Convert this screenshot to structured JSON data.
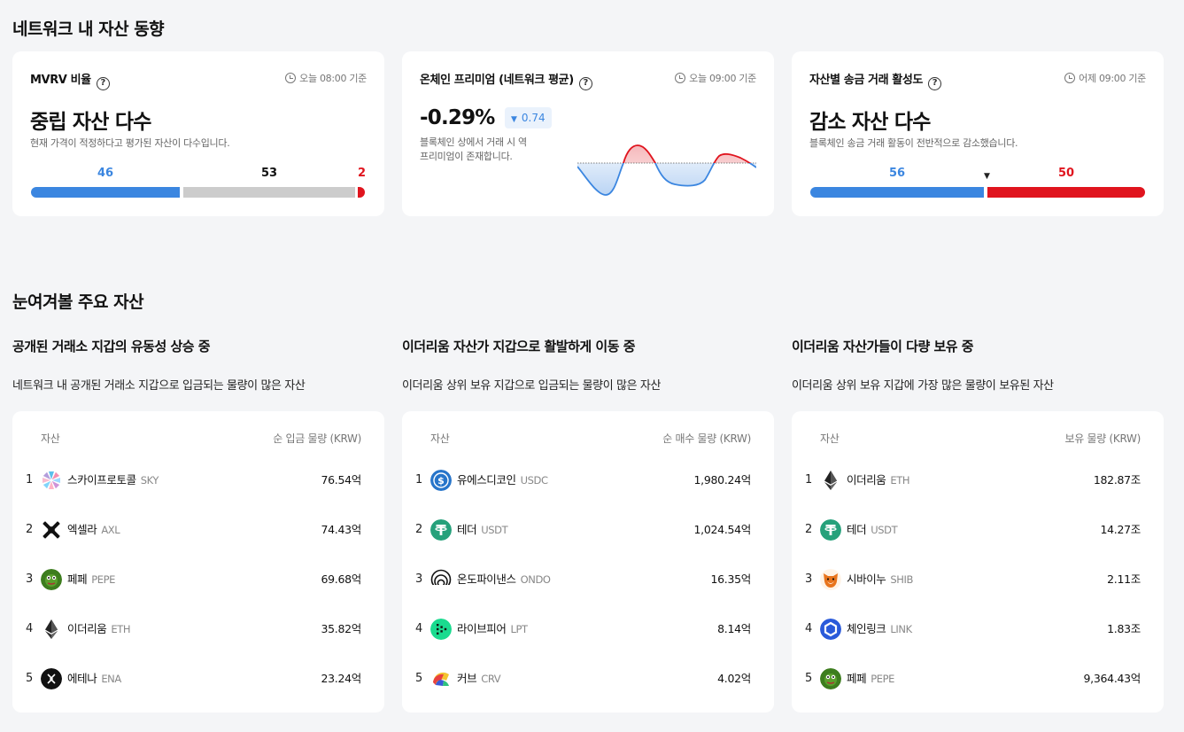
{
  "network_section": {
    "title": "네트워크 내 자산 동향",
    "mvrv": {
      "title": "MVRV 비율",
      "time": "오늘 08:00 기준",
      "headline": "중립 자산 다수",
      "desc": "현재 가격이 적정하다고 평가된 자산이 다수입니다.",
      "low": 46,
      "mid": 53,
      "high": 2,
      "colors": {
        "low": "#3b86e0",
        "mid": "#cccccc",
        "high": "#e0141e"
      }
    },
    "premium": {
      "title": "온체인 프리미엄 (네트워크 평균)",
      "time": "오늘 09:00 기준",
      "headline": "-0.29%",
      "change": "0.74",
      "change_direction": "down",
      "desc": "블록체인 상에서 거래 시 역 프리미엄이 존재합니다.",
      "desc_line1": "블록체인 상에서 거래 시 역",
      "desc_line2": "프리미엄이 존재합니다."
    },
    "activity": {
      "title": "자산별 송금 거래 활성도",
      "time": "어제 09:00 기준",
      "headline": "감소 자산 다수",
      "desc": "블록체인 송금 거래 활동이 전반적으로 감소했습니다.",
      "increase": 56,
      "decrease": 50,
      "colors": {
        "increase": "#3b86e0",
        "decrease": "#e0141e"
      }
    }
  },
  "watch_section": {
    "title": "눈여겨볼 주요 자산",
    "panels": [
      {
        "title": "공개된 거래소 지갑의 유동성 상승 중",
        "desc": "네트워크 내 공개된 거래소 지갑으로 입금되는 물량이 많은 자산",
        "col_asset": "자산",
        "col_value": "순 입금 물량 (KRW)",
        "rows": [
          {
            "rank": "1",
            "name": "스카이프로토콜",
            "symbol": "SKY",
            "value": "76.54억",
            "icon": "sky-icon"
          },
          {
            "rank": "2",
            "name": "엑셀라",
            "symbol": "AXL",
            "value": "74.43억",
            "icon": "axl-icon"
          },
          {
            "rank": "3",
            "name": "페페",
            "symbol": "PEPE",
            "value": "69.68억",
            "icon": "pepe-icon"
          },
          {
            "rank": "4",
            "name": "이더리움",
            "symbol": "ETH",
            "value": "35.82억",
            "icon": "eth-icon"
          },
          {
            "rank": "5",
            "name": "에테나",
            "symbol": "ENA",
            "value": "23.24억",
            "icon": "ena-icon"
          }
        ]
      },
      {
        "title": "이더리움 자산가 지갑으로 활발하게 이동 중",
        "desc": "이더리움 상위 보유 지갑으로 입금되는 물량이 많은 자산",
        "col_asset": "자산",
        "col_value": "순 매수 물량 (KRW)",
        "rows": [
          {
            "rank": "1",
            "name": "유에스디코인",
            "symbol": "USDC",
            "value": "1,980.24억",
            "icon": "usdc-icon"
          },
          {
            "rank": "2",
            "name": "테더",
            "symbol": "USDT",
            "value": "1,024.54억",
            "icon": "usdt-icon"
          },
          {
            "rank": "3",
            "name": "온도파이낸스",
            "symbol": "ONDO",
            "value": "16.35억",
            "icon": "ondo-icon"
          },
          {
            "rank": "4",
            "name": "라이브피어",
            "symbol": "LPT",
            "value": "8.14억",
            "icon": "lpt-icon"
          },
          {
            "rank": "5",
            "name": "커브",
            "symbol": "CRV",
            "value": "4.02억",
            "icon": "crv-icon"
          }
        ]
      },
      {
        "title": "이더리움 자산가들이 다량 보유 중",
        "desc": "이더리움 상위 보유 지갑에 가장 많은 물량이 보유된 자산",
        "col_asset": "자산",
        "col_value": "보유 물량 (KRW)",
        "rows": [
          {
            "rank": "1",
            "name": "이더리움",
            "symbol": "ETH",
            "value": "182.87조",
            "icon": "eth-icon"
          },
          {
            "rank": "2",
            "name": "테더",
            "symbol": "USDT",
            "value": "14.27조",
            "icon": "usdt-icon"
          },
          {
            "rank": "3",
            "name": "시바이누",
            "symbol": "SHIB",
            "value": "2.11조",
            "icon": "shib-icon"
          },
          {
            "rank": "4",
            "name": "체인링크",
            "symbol": "LINK",
            "value": "1.83조",
            "icon": "link-icon"
          },
          {
            "rank": "5",
            "name": "페페",
            "symbol": "PEPE",
            "value": "9,364.43억",
            "icon": "pepe-icon"
          }
        ]
      }
    ]
  }
}
